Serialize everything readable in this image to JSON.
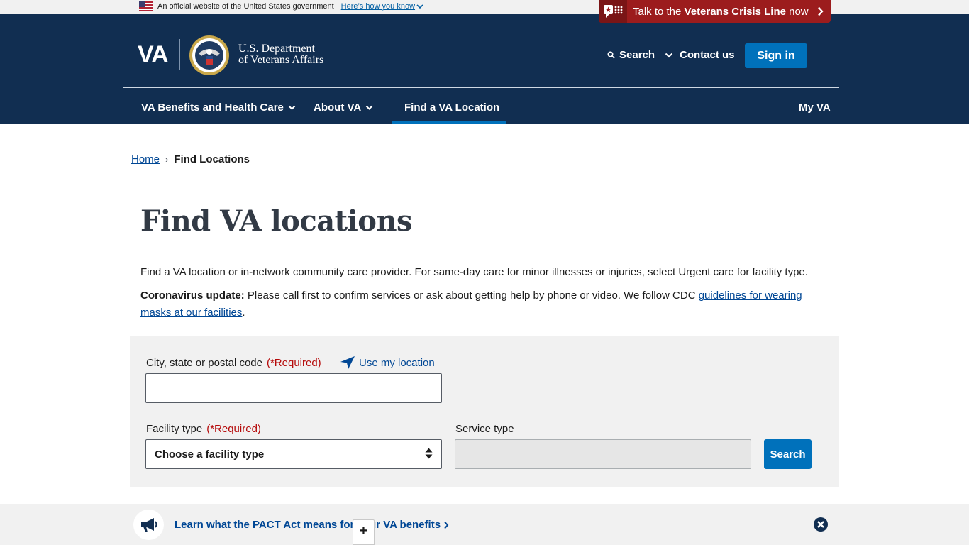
{
  "gov_banner": {
    "text": "An official website of the United States government",
    "link": "Here’s how you know"
  },
  "crisis": {
    "prefix": "Talk to the ",
    "bold": "Veterans Crisis Line",
    "suffix": " now"
  },
  "header": {
    "logo_text": "VA",
    "dept_line1": "U.S. Department",
    "dept_line2": "of Veterans Affairs",
    "search_label": "Search",
    "contact_label": "Contact us",
    "signin_label": "Sign in"
  },
  "nav": {
    "items": [
      {
        "label": "VA Benefits and Health Care"
      },
      {
        "label": "About VA"
      },
      {
        "label": "Find a VA Location"
      },
      {
        "label": "My VA"
      }
    ]
  },
  "breadcrumb": {
    "home": "Home",
    "separator": "›",
    "current": "Find Locations"
  },
  "page": {
    "title": "Find VA locations",
    "intro": "Find a VA location or in-network community care provider. For same-day care for minor illnesses or injuries, select Urgent care for facility type.",
    "covid_bold": "Coronavirus update:",
    "covid_text": " Please call first to confirm services or ask about getting help by phone or video. We follow CDC ",
    "covid_link": "guidelines for wearing masks at our facilities",
    "covid_end": "."
  },
  "form": {
    "location_label": "City, state or postal code",
    "required_text": "(*Required)",
    "use_location": "Use my location",
    "location_value": "",
    "facility_label": "Facility type",
    "facility_selected": "Choose a facility type",
    "service_label": "Service type",
    "service_value": "",
    "search_button": "Search"
  },
  "pact": {
    "link": "Learn what the PACT Act means for your VA benefits"
  },
  "map": {
    "zoom_in": "+"
  },
  "colors": {
    "header_bg": "#112e51",
    "primary": "#0071bb",
    "crisis": "#9c1c1d",
    "required": "#b50909"
  }
}
